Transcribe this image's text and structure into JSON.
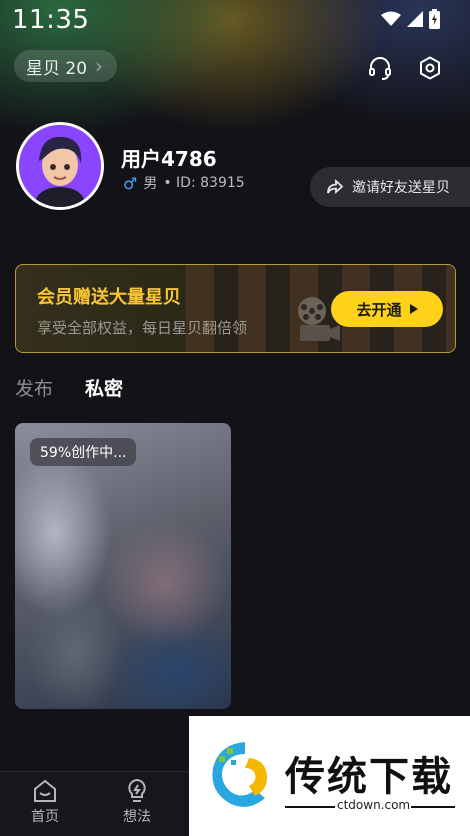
{
  "status_bar": {
    "time": "11:35"
  },
  "header": {
    "coin_label": "星贝 20",
    "coin_chevron": "›"
  },
  "profile": {
    "username": "用户4786",
    "gender": "男",
    "id_text": "• ID: 83915",
    "invite_label": "邀请好友送星贝"
  },
  "vip_banner": {
    "title": "会员赠送大量星贝",
    "subtitle": "享受全部权益，每日星贝翻倍领",
    "button_label": "去开通"
  },
  "tabs": [
    {
      "label": "发布",
      "active": false
    },
    {
      "label": "私密",
      "active": true
    }
  ],
  "cards": [
    {
      "badge": "59%创作中..."
    }
  ],
  "bottom_nav": [
    {
      "label": "首页",
      "icon": "home-icon"
    },
    {
      "label": "想法",
      "icon": "bulb-icon"
    }
  ],
  "watermark": {
    "text": "传统下载",
    "url": "ctdown.com"
  },
  "colors": {
    "accent_yellow": "#ffd21a",
    "vip_title": "#f7c533",
    "background": "#121217"
  }
}
